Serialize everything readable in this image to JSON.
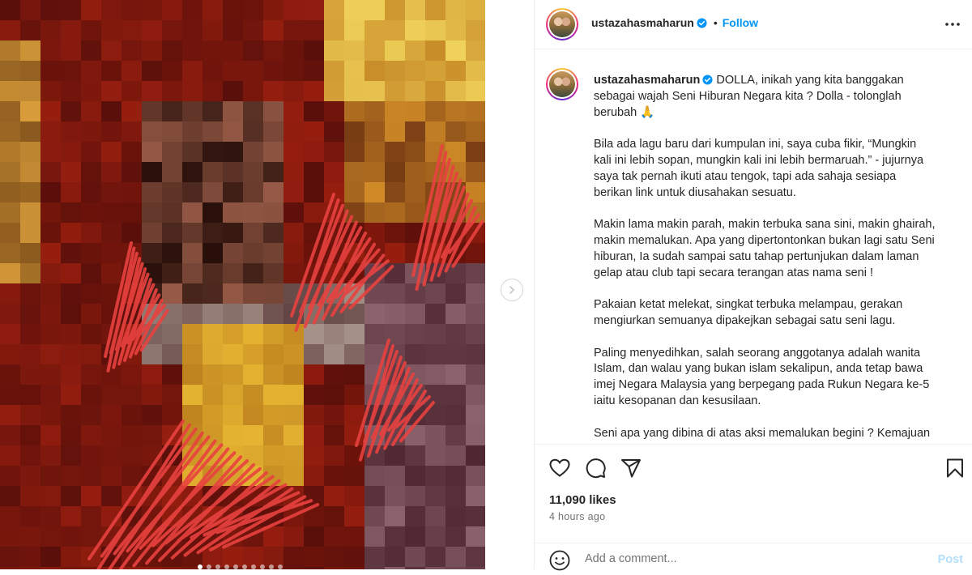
{
  "post": {
    "username": "ustazahasmaharun",
    "separator": "•",
    "follow_label": "Follow",
    "more_icon": "more-options-icon",
    "caption_lines": [
      "DOLLA, inikah yang kita banggakan",
      "sebagai wajah Seni Hiburan Negara kita ? Dolla - tolonglah",
      "berubah 🙏",
      "",
      "Bila ada lagu baru dari kumpulan ini, saya cuba fikir, “Mungkin",
      "kali ini lebih sopan, mungkin kali ini lebih bermaruah.” - jujurnya",
      "saya tak pernah ikuti atau tengok, tapi ada sahaja sesiapa",
      "berikan link untuk diusahakan sesuatu.",
      "",
      "Makin lama makin parah, makin terbuka sana sini, makin ghairah,",
      "makin memalukan. Apa yang dipertontonkan bukan lagi satu Seni",
      "hiburan, Ia sudah sampai satu tahap pertunjukan dalam laman",
      "gelap atau club tapi secara terangan atas nama seni !",
      "",
      "Pakaian ketat melekat, singkat terbuka melampau, gerakan",
      "mengiurkan semuanya dipakejkan sebagai satu seni lagu.",
      "",
      "Paling menyedihkan, salah seorang anggotanya adalah wanita",
      "Islam, dan walau yang bukan islam sekalipun, anda tetap bawa",
      "imej Negara Malaysia yang berpegang pada Rukun Negara ke-5",
      "iaitu kesopanan dan kesusilaan.",
      "",
      "Seni apa yang dibina di atas aksi memalukan begini ? Kemajuan"
    ],
    "likes": "11,090 likes",
    "time": "4 hours ago",
    "comment_placeholder": "Add a comment...",
    "post_label": "Post"
  },
  "media": {
    "carousel_dot_count": 10,
    "active_dot": 0,
    "colors": {
      "base": "#5a1207",
      "scribble": "#e8413f"
    }
  },
  "colors": {
    "accent": "#0095f6",
    "verified": "#0095f6",
    "muted": "#737373",
    "post_disabled": "#b2dffc"
  },
  "icons": [
    "like-icon",
    "comment-icon",
    "share-icon",
    "save-icon",
    "emoji-icon",
    "verified-badge-icon",
    "next-arrow-icon"
  ]
}
